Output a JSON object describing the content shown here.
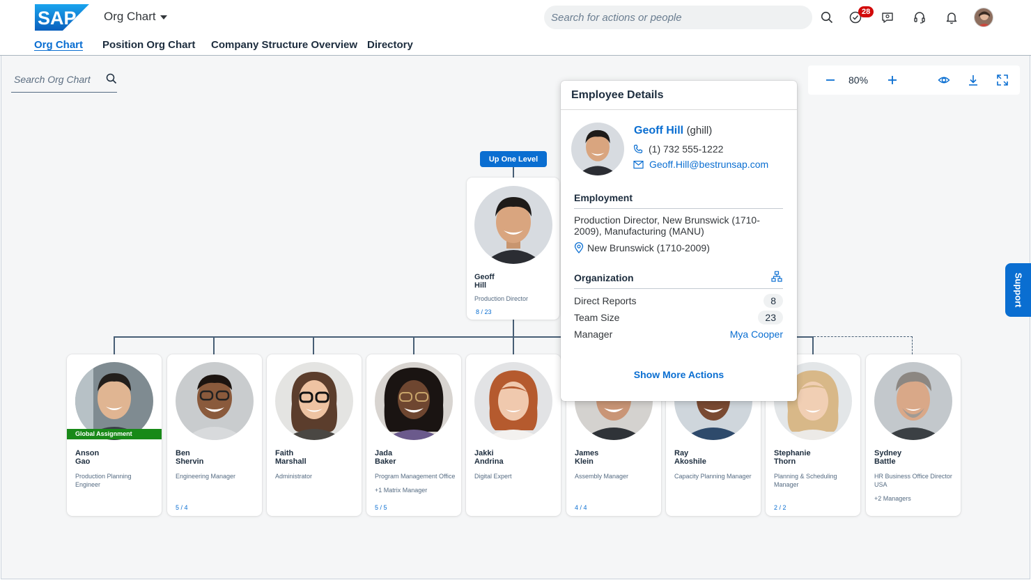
{
  "shell": {
    "logo_text": "SAP",
    "app_title": "Org Chart",
    "search_placeholder": "Search for actions or people",
    "notification_count": "28",
    "icons": [
      "search-icon",
      "task-check-icon",
      "feedback-icon",
      "headset-icon",
      "bell-icon",
      "user-avatar"
    ]
  },
  "tabs": [
    {
      "label": "Org Chart",
      "active": true
    },
    {
      "label": "Position Org Chart",
      "active": false
    },
    {
      "label": "Company Structure Overview",
      "active": false
    },
    {
      "label": "Directory",
      "active": false
    }
  ],
  "org_search": {
    "placeholder": "Search Org Chart"
  },
  "zoom": {
    "value": "80%"
  },
  "support_label": "Support",
  "up_one_level": "Up One Level",
  "top_node": {
    "first": "Geoff",
    "last": "Hill",
    "title": "Production Director",
    "count": "8 / 23"
  },
  "reports": [
    {
      "first": "Anson",
      "last": "Gao",
      "title": "Production Planning Engineer",
      "badge": "Global Assignment",
      "extra": "",
      "count": ""
    },
    {
      "first": "Ben",
      "last": "Shervin",
      "title": "Engineering Manager",
      "extra": "",
      "count": "5 / 4"
    },
    {
      "first": "Faith",
      "last": "Marshall",
      "title": "Administrator",
      "extra": "",
      "count": ""
    },
    {
      "first": "Jada",
      "last": "Baker",
      "title": "Program Management Office",
      "extra": "+1 Matrix Manager",
      "count": "5 / 5"
    },
    {
      "first": "Jakki",
      "last": "Andrina",
      "title": "Digital Expert",
      "extra": "",
      "count": ""
    },
    {
      "first": "James",
      "last": "Klein",
      "title": "Assembly Manager",
      "extra": "",
      "count": "4 / 4"
    },
    {
      "first": "Ray",
      "last": "Akoshile",
      "title": "Capacity Planning Manager",
      "extra": "",
      "count": ""
    },
    {
      "first": "Stephanie",
      "last": "Thorn",
      "title": "Planning & Scheduling Manager",
      "extra": "",
      "count": "2 / 2"
    },
    {
      "first": "Sydney",
      "last": "Battle",
      "title": "HR Business Office Director USA",
      "extra": "+2 Managers",
      "count": ""
    }
  ],
  "popover": {
    "title": "Employee Details",
    "name": "Geoff Hill",
    "user_id": "(ghill)",
    "phone": "(1) 732 555-1222",
    "email": "Geoff.Hill@bestrunsap.com",
    "employment_title": "Employment",
    "employment_text": "Production Director, New Brunswick (1710-2009), Manufacturing (MANU)",
    "location": "New Brunswick (1710-2009)",
    "organization_title": "Organization",
    "direct_reports_label": "Direct Reports",
    "direct_reports": "8",
    "team_size_label": "Team Size",
    "team_size": "23",
    "manager_label": "Manager",
    "manager": "Mya Cooper",
    "show_more": "Show More Actions"
  },
  "colors": {
    "brand": "#0a6ed1",
    "global_assignment": "#188918",
    "badge": "#d20a0a",
    "connector": "#475e75"
  }
}
